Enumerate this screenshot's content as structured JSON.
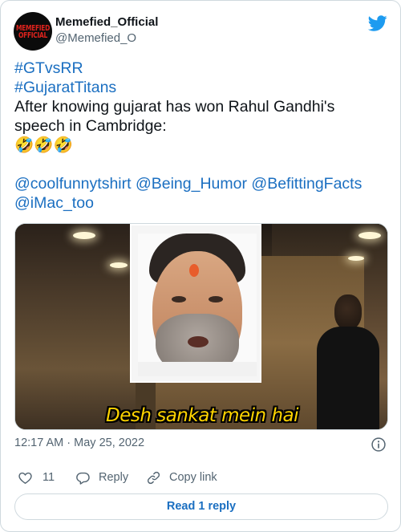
{
  "author": {
    "display_name": "Memefied_Official",
    "handle": "@Memefied_O",
    "avatar_text_line1": "MEMEFIED",
    "avatar_text_line2": "OFFICIAL"
  },
  "icons": {
    "brand": "twitter-bird-icon",
    "info": "info-icon",
    "like": "heart-icon",
    "reply": "reply-bubble-icon",
    "copy": "link-icon"
  },
  "colors": {
    "link": "#1b6fc1",
    "brand": "#1d9bf0",
    "muted": "#536471",
    "caption": "#ffd400"
  },
  "tweet": {
    "hashtag1": "#GTvsRR",
    "hashtag2": "#GujaratTitans",
    "text_line1": "After knowing gujarat has won Rahul Gandhi's",
    "text_line2": "speech in Cambridge:",
    "emojis": "🤣🤣🤣",
    "mention1": "@coolfunnytshirt",
    "mention2": "@Being_Humor",
    "mention3": "@BefittingFacts",
    "mention4": "@iMac_too"
  },
  "media": {
    "caption": "Desh sankat mein hai"
  },
  "meta": {
    "timestamp": "12:17 AM · May 25, 2022"
  },
  "actions": {
    "like_count": "11",
    "reply_label": "Reply",
    "copy_label": "Copy link"
  },
  "read_replies_label": "Read 1 reply"
}
